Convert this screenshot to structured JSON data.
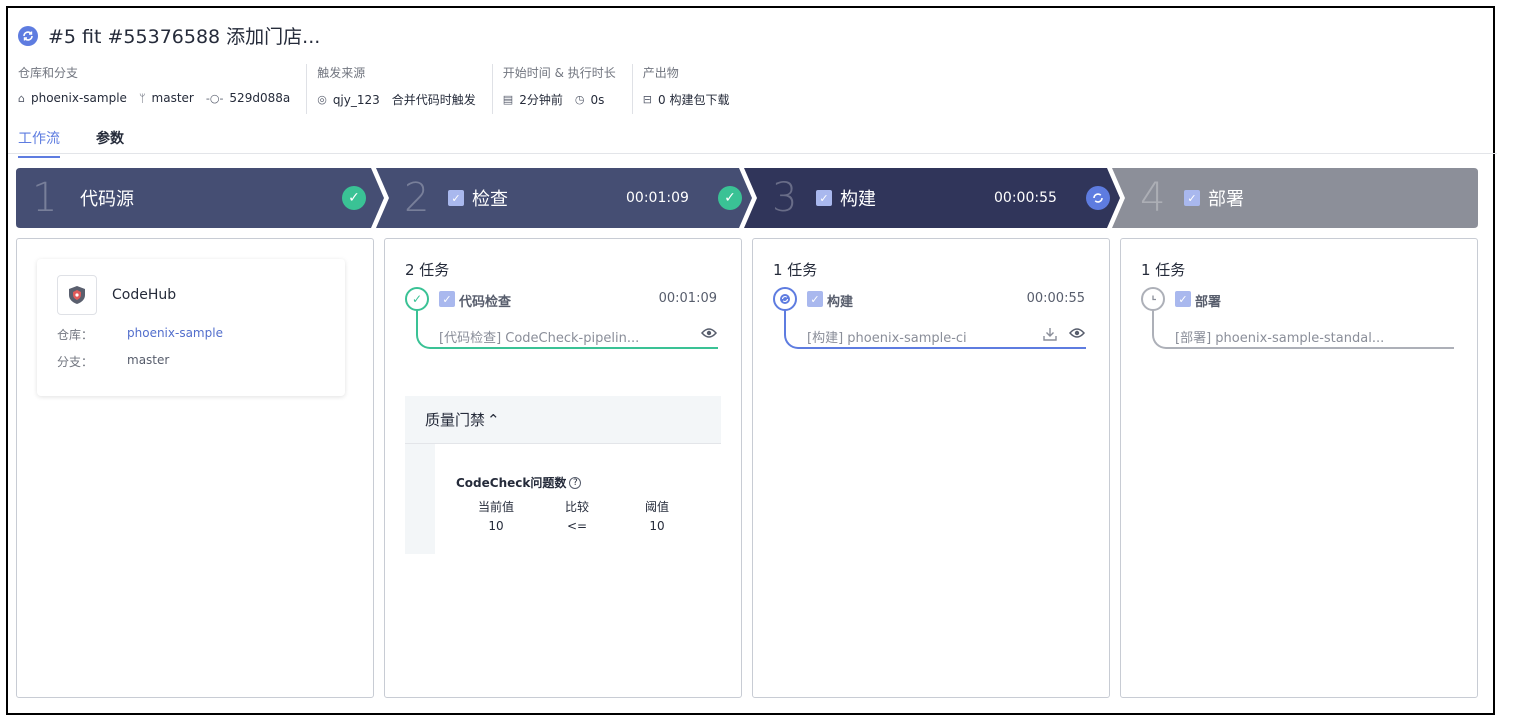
{
  "header": {
    "title": "#5  fit #55376588 添加门店...",
    "meta": {
      "repo_label": "仓库和分支",
      "repo": "phoenix-sample",
      "branch": "master",
      "commit": "529d088a",
      "trigger_label": "触发来源",
      "trigger_user": "qjy_123",
      "trigger_desc": "合并代码时触发",
      "time_label": "开始时间 & 执行时长",
      "start": "2分钟前",
      "duration": "0s",
      "artifact_label": "产出物",
      "artifact": "0 构建包下载"
    },
    "tabs": [
      {
        "label": "工作流",
        "active": true
      },
      {
        "label": "参数",
        "active": false
      }
    ]
  },
  "stages": [
    {
      "num": "1",
      "name": "代码源",
      "time": "",
      "status": "success",
      "color": "#454e73"
    },
    {
      "num": "2",
      "name": "检查",
      "time": "00:01:09",
      "status": "success",
      "color": "#454e73"
    },
    {
      "num": "3",
      "name": "构建",
      "time": "00:00:55",
      "status": "running",
      "color": "#30355a"
    },
    {
      "num": "4",
      "name": "部署",
      "time": "",
      "status": "pending",
      "color": "#8c8f99"
    }
  ],
  "source_card": {
    "name": "CodeHub",
    "repo_label": "仓库：",
    "repo": "phoenix-sample",
    "branch_label": "分支：",
    "branch": "master"
  },
  "panels": {
    "check": {
      "count": "2 任务",
      "job": {
        "name": "代码检查",
        "time": "00:01:09",
        "desc": "[代码检查] CodeCheck-pipelin...",
        "color": "#3ac295"
      },
      "gate": {
        "title": "质量门禁",
        "metric": "CodeCheck问题数",
        "headers": [
          "当前值",
          "比较",
          "阈值"
        ],
        "values": [
          "10",
          "<=",
          "10"
        ]
      }
    },
    "build": {
      "count": "1 任务",
      "job": {
        "name": "构建",
        "time": "00:00:55",
        "desc": "[构建] phoenix-sample-ci",
        "color": "#5e7ce0"
      }
    },
    "deploy": {
      "count": "1 任务",
      "job": {
        "name": "部署",
        "time": "",
        "desc": "[部署] phoenix-sample-standal...",
        "color": "#adb0b8"
      }
    }
  }
}
